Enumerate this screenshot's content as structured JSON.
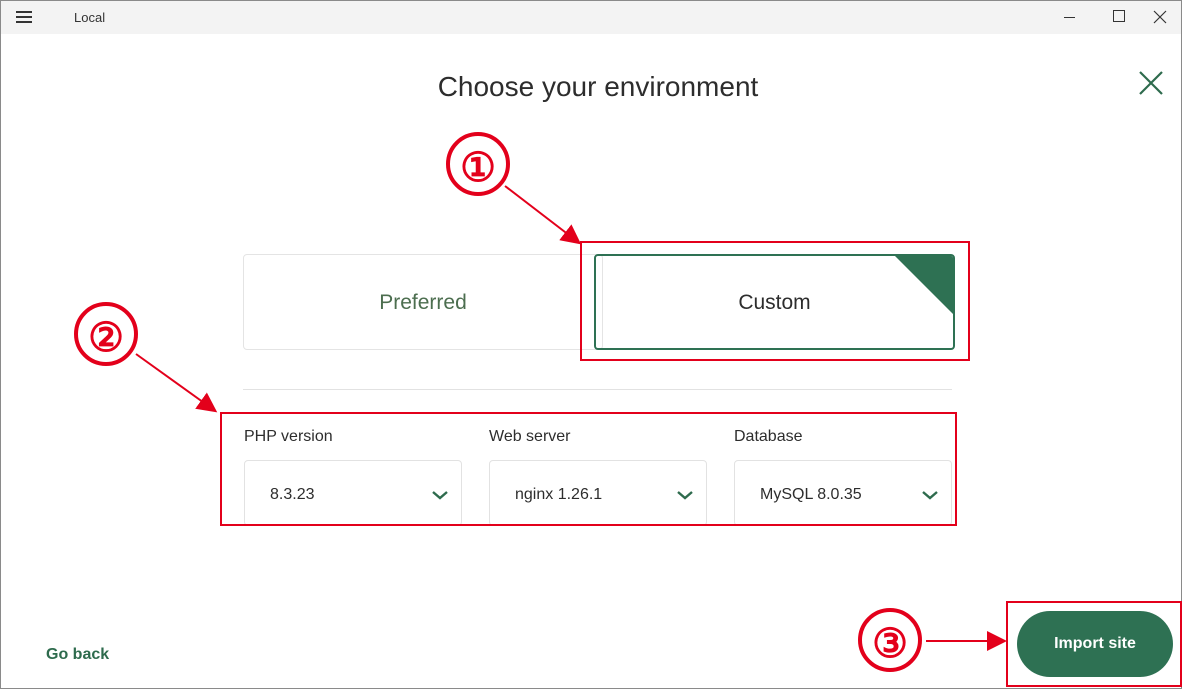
{
  "window": {
    "title": "Local",
    "menu_icon": "hamburger-menu-icon",
    "controls": [
      "minimize-icon",
      "maximize-icon",
      "close-icon"
    ]
  },
  "modal": {
    "title": "Choose your environment",
    "close_icon": "close-x-icon"
  },
  "environment_options": {
    "preferred": {
      "label": "Preferred",
      "selected": false
    },
    "custom": {
      "label": "Custom",
      "selected": true,
      "check_icon": "checkmark-icon"
    }
  },
  "fields": {
    "php": {
      "label": "PHP version",
      "value": "8.3.23"
    },
    "web_server": {
      "label": "Web server",
      "value": "nginx 1.26.1"
    },
    "database": {
      "label": "Database",
      "value": "MySQL 8.0.35"
    }
  },
  "footer": {
    "go_back": "Go back",
    "import_site": "Import site"
  },
  "annotations": {
    "one": "①",
    "two": "②",
    "three": "③"
  },
  "colors": {
    "accent": "#2e7153",
    "annotation_red": "#e3001b",
    "preferred_text": "#4c6e4f"
  }
}
